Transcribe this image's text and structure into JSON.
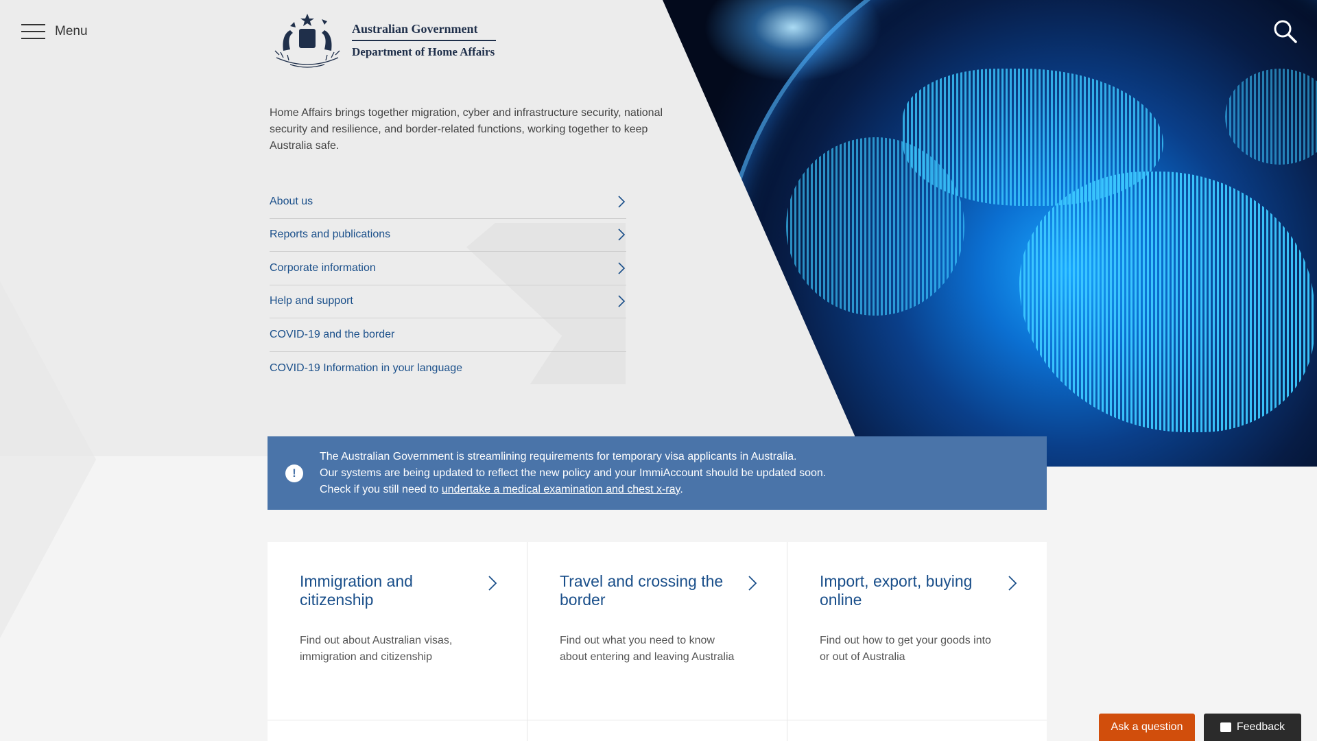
{
  "header": {
    "menu_label": "Menu",
    "logo": {
      "line1": "Australian Government",
      "line2": "Department of Home Affairs"
    }
  },
  "intro": "Home Affairs brings together migration, cyber and infrastructure security, national security and resilience, and border-related functions, working together to keep Australia safe.",
  "quick_links": [
    {
      "label": "About us",
      "has_chevron": true
    },
    {
      "label": "Reports and publications",
      "has_chevron": true
    },
    {
      "label": "Corporate information",
      "has_chevron": true
    },
    {
      "label": "Help and support",
      "has_chevron": true
    },
    {
      "label": "COVID-19 and the border",
      "has_chevron": false
    },
    {
      "label": "COVID-19 Information in your language",
      "has_chevron": false
    }
  ],
  "alert": {
    "icon": "alert-icon",
    "line1": "The Australian Government is streamlining requirements for temporary visa applicants in Australia.",
    "line2": "Our systems are being updated to reflect the new policy and your ImmiAccount should be updated soon.",
    "line3_prefix": "Check if you still need to ",
    "line3_link": "undertake a medical examination and chest x-ray",
    "line3_suffix": ".",
    "bg_color": "#4a74a9"
  },
  "cards": [
    {
      "title": "Immigration and citizenship",
      "desc": "Find out about Australian visas, immigration and citizenship"
    },
    {
      "title": "Travel and crossing the border",
      "desc": "Find out what you need to know about entering and leaving Australia"
    },
    {
      "title": "Import, export, buying online",
      "desc": "Find out how to get your goods into or out of Australia"
    }
  ],
  "footer_buttons": {
    "ask_label": "Ask a question",
    "ask_color": "#d14e0c",
    "feedback_label": "Feedback",
    "feedback_color": "#2b2b2b"
  },
  "colors": {
    "link": "#1a4f8a",
    "brand_navy": "#1f2f4a"
  }
}
